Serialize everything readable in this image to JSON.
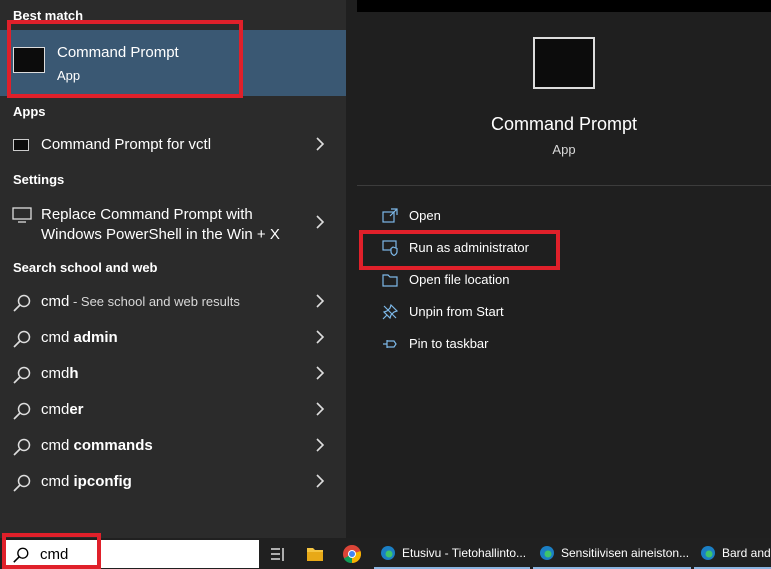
{
  "left": {
    "best_match": {
      "header": "Best match",
      "title": "Command Prompt",
      "subtitle": "App"
    },
    "apps": {
      "header": "Apps",
      "items": [
        {
          "label": "Command Prompt for vctl"
        }
      ]
    },
    "settings": {
      "header": "Settings",
      "items": [
        {
          "line1": "Replace Command Prompt with",
          "line2": "Windows PowerShell in the Win + X"
        }
      ]
    },
    "web": {
      "header": "Search school and web",
      "items": [
        {
          "query": "cmd",
          "suffix": " - See school and web results"
        },
        {
          "query": "cmd ",
          "bold": "admin"
        },
        {
          "query": "cmd",
          "bold": "h"
        },
        {
          "query": "cmd",
          "bold": "er"
        },
        {
          "query": "cmd ",
          "bold": "commands"
        },
        {
          "query": "cmd ",
          "bold": "ipconfig"
        }
      ]
    }
  },
  "right": {
    "title": "Command Prompt",
    "subtitle": "App",
    "actions": [
      {
        "label": "Open",
        "icon": "open-icon"
      },
      {
        "label": "Run as administrator",
        "icon": "shield-icon"
      },
      {
        "label": "Open file location",
        "icon": "folder-icon"
      },
      {
        "label": "Unpin from Start",
        "icon": "unpin-icon"
      },
      {
        "label": "Pin to taskbar",
        "icon": "pin-icon"
      }
    ]
  },
  "taskbar": {
    "search_value": "cmd",
    "apps": [
      {
        "label": "Etusivu - Tietohallinto..."
      },
      {
        "label": "Sensitiivisen aineiston..."
      },
      {
        "label": "Bard and"
      }
    ]
  },
  "colors": {
    "selected_bg": "#3a5873",
    "highlight_box": "#e0202a",
    "left_bg": "#2b2b2b",
    "right_bg": "#1f1f1f"
  }
}
